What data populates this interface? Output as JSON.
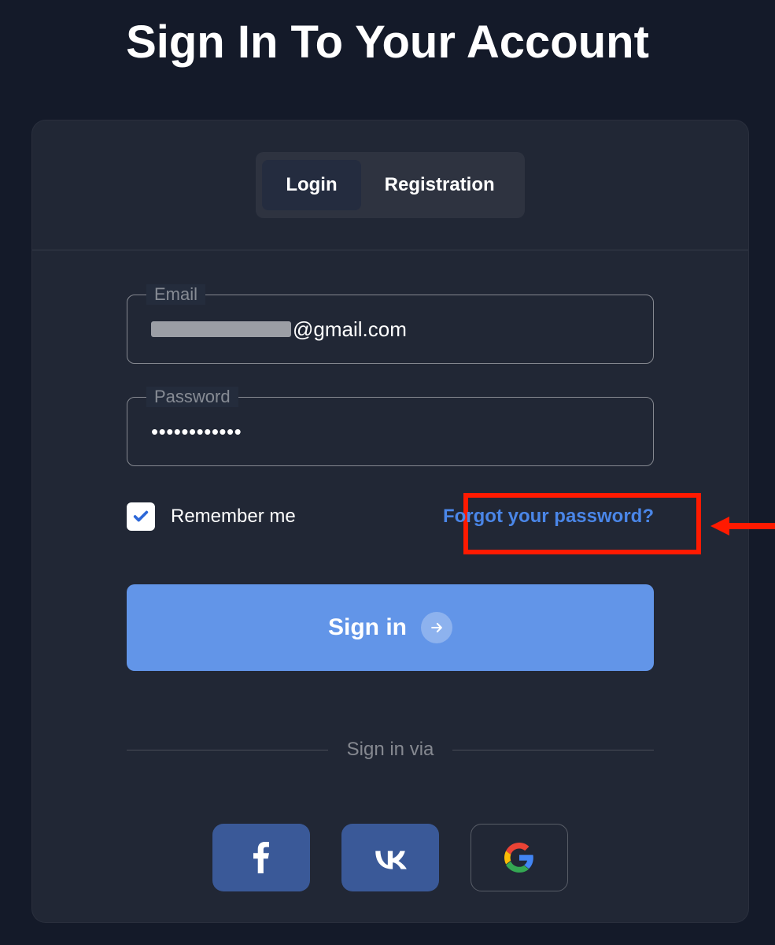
{
  "title": "Sign In To Your Account",
  "tabs": {
    "login": "Login",
    "registration": "Registration"
  },
  "fields": {
    "email_label": "Email",
    "email_visible_suffix": "@gmail.com",
    "password_label": "Password",
    "password_value": "••••••••••••"
  },
  "remember": {
    "label": "Remember me"
  },
  "forgot": {
    "label": "Forgot your password?"
  },
  "signin": {
    "label": "Sign in"
  },
  "via": {
    "label": "Sign in via"
  },
  "colors": {
    "accent": "#6295e8",
    "link": "#4a86e8",
    "highlight": "#ff1a00"
  }
}
